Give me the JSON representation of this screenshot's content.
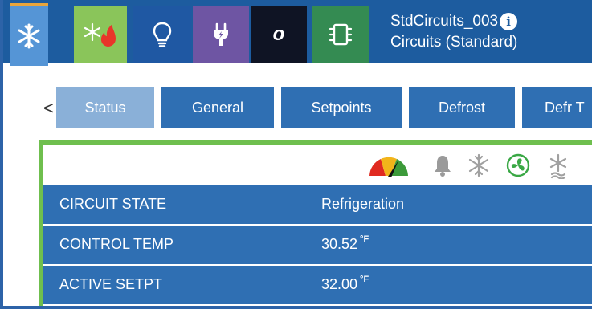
{
  "toolbar": {
    "tools": [
      {
        "name": "snowflake-icon"
      },
      {
        "name": "snowflake-flame-icon"
      },
      {
        "name": "lightbulb-icon"
      },
      {
        "name": "plug-icon"
      },
      {
        "name": "o-icon",
        "label": "o"
      },
      {
        "name": "chip-icon"
      }
    ],
    "title": "StdCircuits_003",
    "subtitle": "Circuits (Standard)",
    "info_glyph": "i"
  },
  "tabs": {
    "prev_arrow": "<",
    "items": [
      {
        "label": "Status",
        "active": true
      },
      {
        "label": "General"
      },
      {
        "label": "Setpoints"
      },
      {
        "label": "Defrost"
      },
      {
        "label": "Defr T"
      }
    ]
  },
  "status_icons": [
    "gauge-icon",
    "bell-icon",
    "snowflake-icon",
    "fan-icon",
    "defrost-icon"
  ],
  "rows": [
    {
      "key": "CIRCUIT STATE",
      "value": "Refrigeration",
      "unit": ""
    },
    {
      "key": "CONTROL TEMP",
      "value": "30.52",
      "unit": "°F"
    },
    {
      "key": "ACTIVE SETPT",
      "value": "32.00",
      "unit": "°F"
    }
  ],
  "colors": {
    "toolbar_bg": "#1d5c9f",
    "tab_bg": "#2f6fb3",
    "tab_active": "#8ab0d8",
    "panel_border": "#6fbf4e"
  }
}
